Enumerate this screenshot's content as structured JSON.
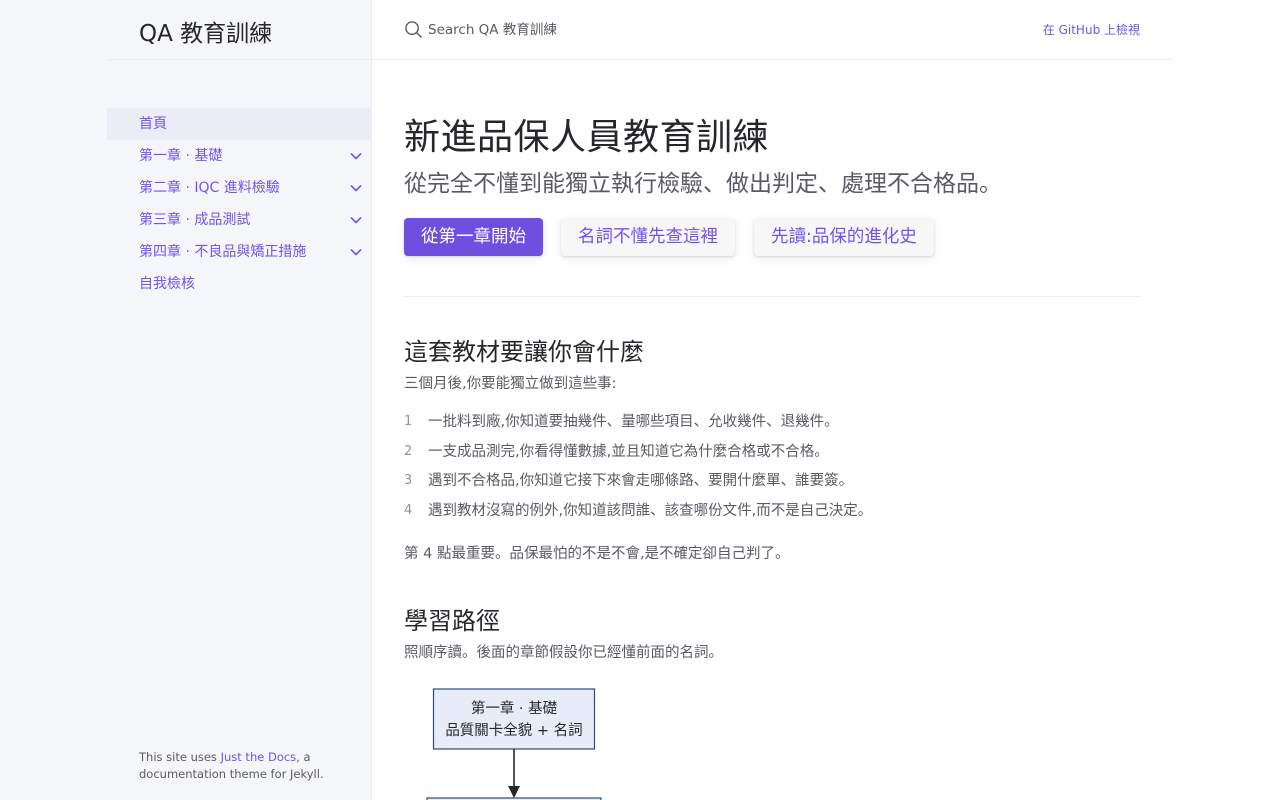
{
  "site": {
    "title": "QA 教育訓練"
  },
  "search": {
    "placeholder": "Search QA 教育訓練"
  },
  "header": {
    "github_link": "在 GitHub 上檢視"
  },
  "sidebar": {
    "items": [
      {
        "label": "首頁",
        "active": true,
        "expandable": false
      },
      {
        "label": "第一章 · 基礎",
        "active": false,
        "expandable": true
      },
      {
        "label": "第二章 · IQC 進料檢驗",
        "active": false,
        "expandable": true
      },
      {
        "label": "第三章 · 成品測試",
        "active": false,
        "expandable": true
      },
      {
        "label": "第四章 · 不良品與矯正措施",
        "active": false,
        "expandable": true
      },
      {
        "label": "自我檢核",
        "active": false,
        "expandable": false
      }
    ],
    "footer": {
      "prefix": "This site uses ",
      "link": "Just the Docs",
      "suffix": ", a documentation theme for Jekyll."
    }
  },
  "main": {
    "title": "新進品保人員教育訓練",
    "lead": "從完全不懂到能獨立執行檢驗、做出判定、處理不合格品。",
    "buttons": {
      "start": "從第一章開始",
      "glossary": "名詞不懂先查這裡",
      "history": "先讀:品保的進化史"
    },
    "section1": {
      "heading": "這套教材要讓你會什麼",
      "intro": "三個月後,你要能獨立做到這些事:",
      "list": [
        {
          "num": "1",
          "text": "一批料到廠,你知道要抽幾件、量哪些項目、允收幾件、退幾件。"
        },
        {
          "num": "2",
          "text": "一支成品測完,你看得懂數據,並且知道它為什麼合格或不合格。"
        },
        {
          "num": "3",
          "text": "遇到不合格品,你知道它接下來會走哪條路、要開什麼單、誰要簽。"
        },
        {
          "num": "4",
          "text": "遇到教材沒寫的例外,你知道該問誰、該查哪份文件,而不是自己決定。"
        }
      ],
      "note": "第 4 點最重要。品保最怕的不是不會,是不確定卻自己判了。"
    },
    "section2": {
      "heading": "學習路徑",
      "intro": "照順序讀。後面的章節假設你已經懂前面的名詞。",
      "flow": {
        "node1_line1": "第一章 · 基礎",
        "node1_line2": "品質關卡全貌 + 名詞"
      }
    }
  },
  "colors": {
    "accent": "#7253ed",
    "primary_button": "#6f4fe0",
    "sidebar_bg": "#f5f6fa",
    "text": "#27262b",
    "muted_text": "#5c5962",
    "flow_node_fill": "#e6ecf8",
    "flow_node_stroke": "#2f4a7a"
  }
}
